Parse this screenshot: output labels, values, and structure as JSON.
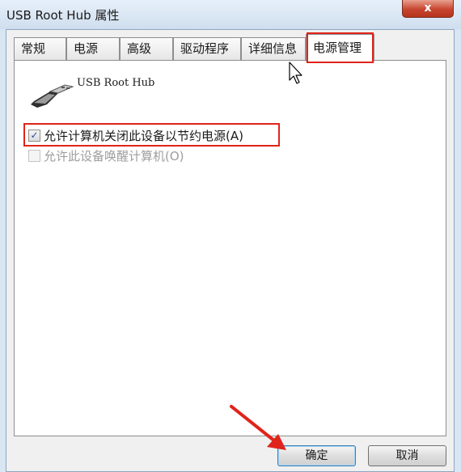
{
  "window": {
    "title": "USB Root Hub 属性",
    "close_label": "x"
  },
  "tabs": [
    {
      "label": "常规"
    },
    {
      "label": "电源"
    },
    {
      "label": "高级"
    },
    {
      "label": "驱动程序"
    },
    {
      "label": "详细信息"
    },
    {
      "label": "电源管理",
      "active": true
    }
  ],
  "device": {
    "name": "USB Root Hub",
    "icon": "usb-plug-icon"
  },
  "options": [
    {
      "label": "允许计算机关闭此设备以节约电源(A)",
      "checked": true,
      "enabled": true
    },
    {
      "label": "允许此设备唤醒计算机(O)",
      "checked": false,
      "enabled": false
    }
  ],
  "buttons": {
    "ok": "确定",
    "cancel": "取消"
  },
  "colors": {
    "highlight": "#e0241b",
    "title_bg": "#cfdeee",
    "close_bg": "#c7452f"
  }
}
